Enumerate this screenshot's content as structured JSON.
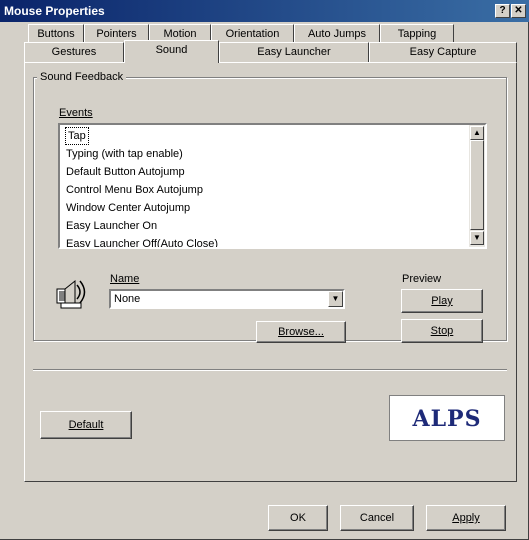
{
  "window": {
    "title": "Mouse Properties",
    "help_button": "?",
    "close_button": "✕"
  },
  "tabs_row1": [
    {
      "label": "Buttons"
    },
    {
      "label": "Pointers"
    },
    {
      "label": "Motion"
    },
    {
      "label": "Orientation"
    },
    {
      "label": "Auto Jumps"
    },
    {
      "label": "Tapping"
    }
  ],
  "tabs_row2": [
    {
      "label": "Gestures"
    },
    {
      "label": "Sound"
    },
    {
      "label": "Easy Launcher"
    },
    {
      "label": "Easy Capture"
    }
  ],
  "sound_feedback": {
    "group_label": "Sound Feedback",
    "events_label": "Events",
    "events": [
      "Tap",
      "Typing (with tap enable)",
      "Default Button Autojump",
      "Control Menu Box Autojump",
      "Window Center Autojump",
      "Easy Launcher On",
      "Easy Launcher Off(Auto Close)"
    ],
    "name_label": "Name",
    "name_value": "None",
    "browse_label": "Browse...",
    "preview_label": "Preview",
    "play_label": "Play",
    "stop_label": "Stop"
  },
  "default_label": "Default",
  "logo_text": "ALPS",
  "footer": {
    "ok_label": "OK",
    "cancel_label": "Cancel",
    "apply_label": "Apply"
  }
}
